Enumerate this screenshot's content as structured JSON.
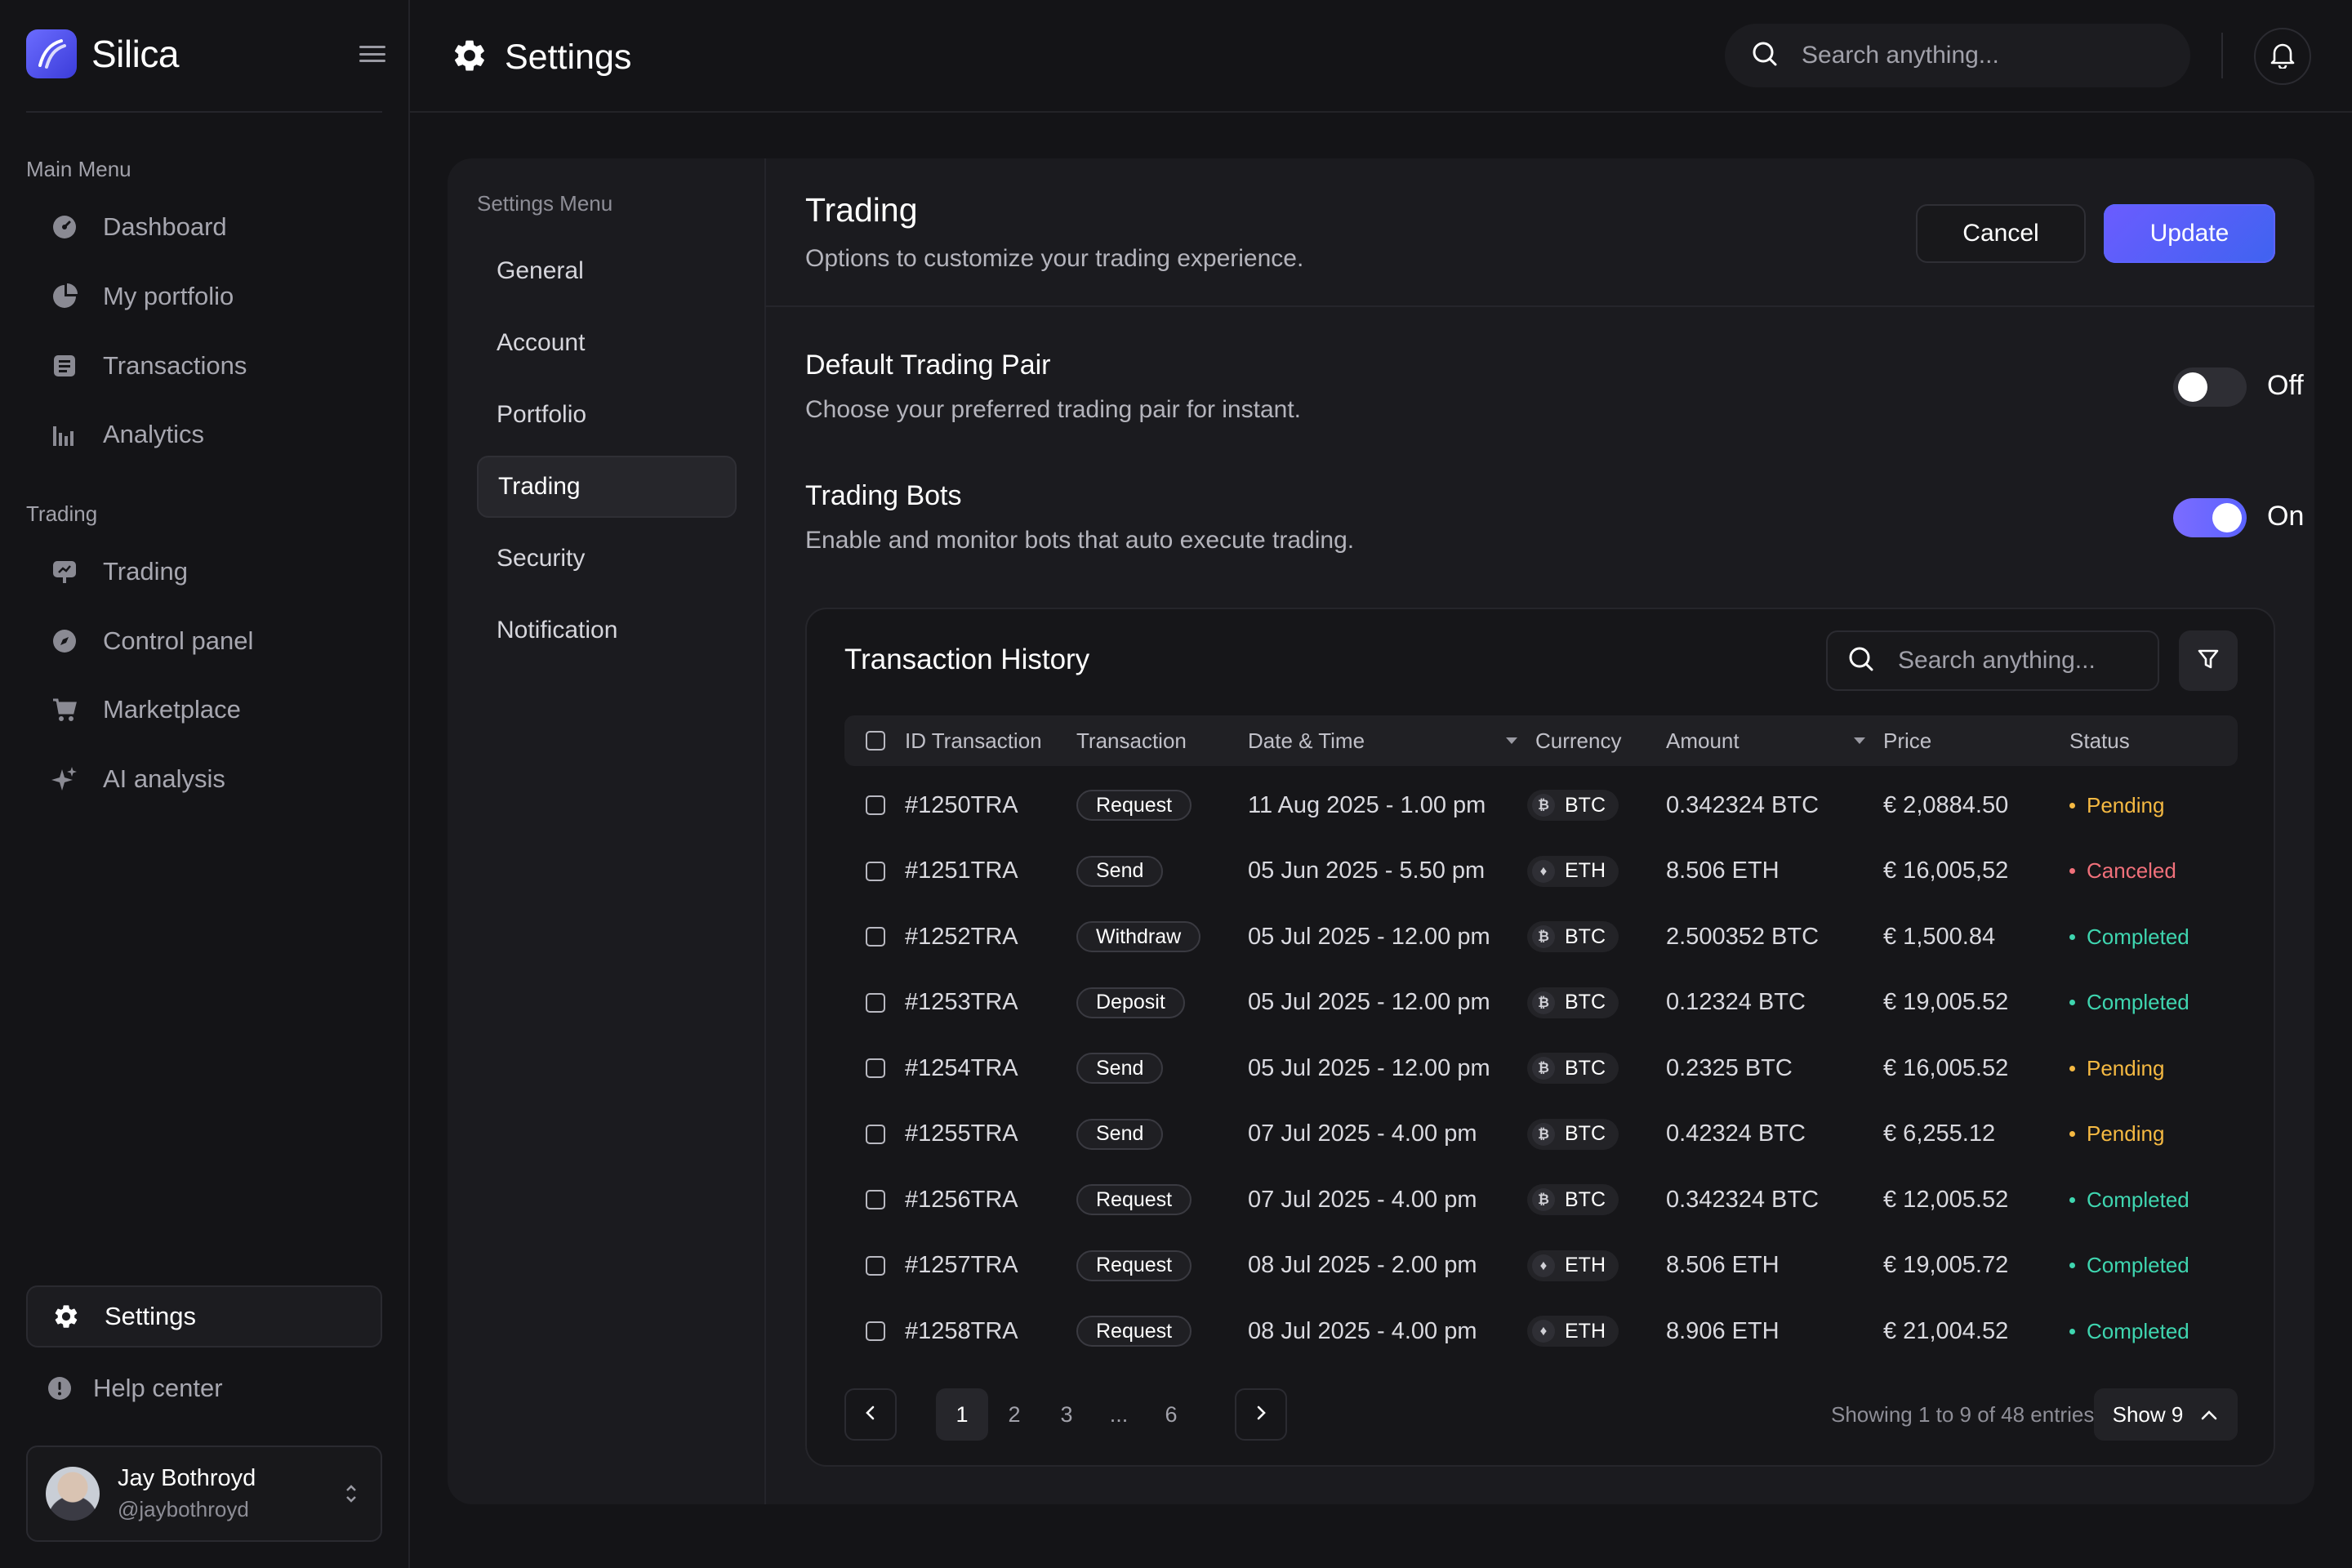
{
  "brand": {
    "name": "Silica"
  },
  "sidebar": {
    "main_menu_title": "Main Menu",
    "main_items": [
      {
        "label": "Dashboard",
        "icon": "dashboard-icon"
      },
      {
        "label": "My portfolio",
        "icon": "pie-chart-icon"
      },
      {
        "label": "Transactions",
        "icon": "receipt-icon"
      },
      {
        "label": "Analytics",
        "icon": "bar-chart-icon"
      }
    ],
    "trading_title": "Trading",
    "trading_items": [
      {
        "label": "Trading",
        "icon": "presentation-icon"
      },
      {
        "label": "Control panel",
        "icon": "compass-icon"
      },
      {
        "label": "Marketplace",
        "icon": "cart-icon"
      },
      {
        "label": "AI analysis",
        "icon": "sparkle-icon"
      }
    ],
    "settings_label": "Settings",
    "help_label": "Help center",
    "user": {
      "name": "Jay Bothroyd",
      "handle": "@jaybothroyd"
    }
  },
  "header": {
    "title": "Settings",
    "search_placeholder": "Search anything..."
  },
  "settings_menu": {
    "title": "Settings Menu",
    "items": [
      "General",
      "Account",
      "Portfolio",
      "Trading",
      "Security",
      "Notification"
    ],
    "active": "Trading"
  },
  "section": {
    "title": "Trading",
    "subtitle": "Options to customize your trading experience.",
    "cancel_label": "Cancel",
    "update_label": "Update"
  },
  "options": [
    {
      "title": "Default Trading Pair",
      "description": "Choose your preferred trading pair for instant.",
      "state_label": "Off",
      "enabled": false
    },
    {
      "title": "Trading Bots",
      "description": "Enable and monitor bots that auto execute trading.",
      "state_label": "On",
      "enabled": true
    }
  ],
  "transactions": {
    "title": "Transaction History",
    "search_placeholder": "Search anything...",
    "columns": [
      "ID Transaction",
      "Transaction",
      "Date & Time",
      "Currency",
      "Amount",
      "Price",
      "Status"
    ],
    "rows": [
      {
        "id": "#1250TRA",
        "type": "Request",
        "datetime": "11 Aug 2025 - 1.00 pm",
        "currency": "BTC",
        "amount": "0.342324 BTC",
        "price": "€ 2,0884.50",
        "status": "Pending"
      },
      {
        "id": "#1251TRA",
        "type": "Send",
        "datetime": "05 Jun 2025 - 5.50 pm",
        "currency": "ETH",
        "amount": "8.506 ETH",
        "price": "€ 16,005,52",
        "status": "Canceled"
      },
      {
        "id": "#1252TRA",
        "type": "Withdraw",
        "datetime": "05 Jul 2025 - 12.00 pm",
        "currency": "BTC",
        "amount": "2.500352 BTC",
        "price": "€ 1,500.84",
        "status": "Completed"
      },
      {
        "id": "#1253TRA",
        "type": "Deposit",
        "datetime": "05 Jul 2025 - 12.00 pm",
        "currency": "BTC",
        "amount": "0.12324 BTC",
        "price": "€ 19,005.52",
        "status": "Completed"
      },
      {
        "id": "#1254TRA",
        "type": "Send",
        "datetime": "05 Jul 2025 - 12.00 pm",
        "currency": "BTC",
        "amount": "0.2325 BTC",
        "price": "€ 16,005.52",
        "status": "Pending"
      },
      {
        "id": "#1255TRA",
        "type": "Send",
        "datetime": "07 Jul 2025 - 4.00 pm",
        "currency": "BTC",
        "amount": "0.42324 BTC",
        "price": "€ 6,255.12",
        "status": "Pending"
      },
      {
        "id": "#1256TRA",
        "type": "Request",
        "datetime": "07 Jul 2025 - 4.00 pm",
        "currency": "BTC",
        "amount": "0.342324 BTC",
        "price": "€ 12,005.52",
        "status": "Completed"
      },
      {
        "id": "#1257TRA",
        "type": "Request",
        "datetime": "08 Jul 2025 - 2.00 pm",
        "currency": "ETH",
        "amount": "8.506 ETH",
        "price": "€ 19,005.72",
        "status": "Completed"
      },
      {
        "id": "#1258TRA",
        "type": "Request",
        "datetime": "08 Jul 2025 - 4.00 pm",
        "currency": "ETH",
        "amount": "8.906 ETH",
        "price": "€ 21,004.52",
        "status": "Completed"
      }
    ],
    "pagination": {
      "pages": [
        "1",
        "2",
        "3",
        "...",
        "6"
      ],
      "current": "1",
      "summary": "Showing 1 to 9 of 48 entries",
      "page_size_label": "Show 9"
    }
  },
  "colors": {
    "accent": "#5d63ff",
    "pending": "#f5b942",
    "canceled": "#f0707a",
    "completed": "#3fd6b0"
  }
}
